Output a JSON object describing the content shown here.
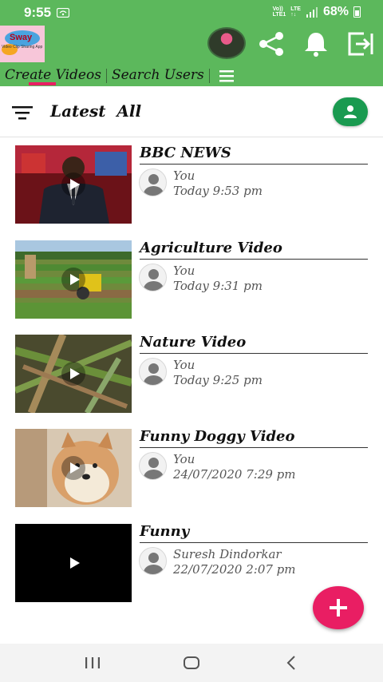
{
  "status_bar": {
    "time": "9:55",
    "network_line1": "Vo))",
    "network_line2": "LTE1",
    "network_type_top": "LTE",
    "network_type_bottom": "↑↓",
    "battery": "68%",
    "icons": [
      "wifi-icon",
      "signal-icon",
      "battery-icon"
    ]
  },
  "app_bar": {
    "logo_text": "Sway",
    "logo_subtext": "Video Clip Sharing App",
    "icons": [
      "avatar",
      "share-icon",
      "bell-icon",
      "logout-icon"
    ]
  },
  "tabs": {
    "create": "Create Videos",
    "search": "Search Users",
    "menu_icon": "hamburger-menu-icon"
  },
  "filter_bar": {
    "title": "Latest  All",
    "sort_icon": "sort-icon",
    "profile_icon": "person-icon"
  },
  "videos": [
    {
      "title": "BBC NEWS",
      "user": "You",
      "date": "Today 9:53 pm",
      "thumb": "news-anchor"
    },
    {
      "title": "Agriculture Video",
      "user": "You",
      "date": "Today 9:31 pm",
      "thumb": "field"
    },
    {
      "title": "Nature Video",
      "user": "You",
      "date": "Today 9:25 pm",
      "thumb": "nature"
    },
    {
      "title": "Funny Doggy Video",
      "user": "You",
      "date": "24/07/2020 7:29 pm",
      "thumb": "dog"
    },
    {
      "title": "Funny",
      "user": "Suresh Dindorkar",
      "date": "22/07/2020 2:07 pm",
      "thumb": "black"
    }
  ],
  "colors": {
    "app_green": "#5cb85c",
    "accent_pink": "#e91e63",
    "profile_green": "#1a9a50"
  },
  "nav_bar": {
    "icons": [
      "recents-icon",
      "home-icon",
      "back-icon"
    ]
  }
}
